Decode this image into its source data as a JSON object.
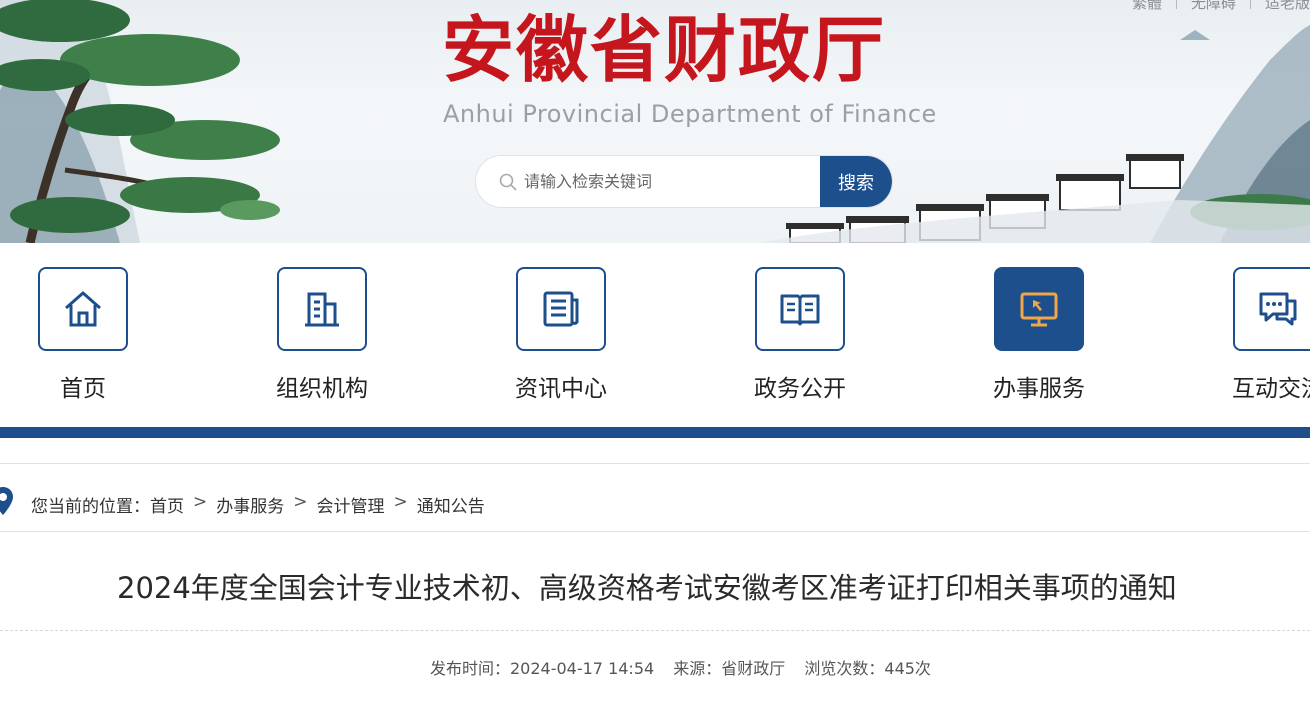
{
  "header": {
    "top_links": [
      "繁體",
      "无障碍",
      "适老版"
    ],
    "title": "安徽省财政厅",
    "subtitle": "Anhui Provincial Department of Finance",
    "search": {
      "placeholder": "请输入检索关键词",
      "button": "搜索"
    }
  },
  "nav": {
    "items": [
      {
        "label": "首页",
        "icon": "home-icon"
      },
      {
        "label": "组织机构",
        "icon": "building-icon"
      },
      {
        "label": "资讯中心",
        "icon": "newspaper-icon"
      },
      {
        "label": "政务公开",
        "icon": "open-book-icon"
      },
      {
        "label": "办事服务",
        "icon": "monitor-cursor-icon",
        "active": true
      },
      {
        "label": "互动交流",
        "icon": "chat-bubbles-icon"
      }
    ]
  },
  "breadcrumb": {
    "prefix": "您当前的位置：",
    "items": [
      "首页",
      "办事服务",
      "会计管理",
      "通知公告"
    ],
    "separator": ">"
  },
  "article": {
    "title": "2024年度全国会计专业技术初、高级资格考试安徽考区准考证打印相关事项的通知",
    "publish_time": "发布时间：2024-04-17 14:54",
    "source": "来源：省财政厅",
    "views": "浏览次数：445次"
  },
  "colors": {
    "brand_blue": "#1d4f8c",
    "title_red": "#c4161c"
  }
}
